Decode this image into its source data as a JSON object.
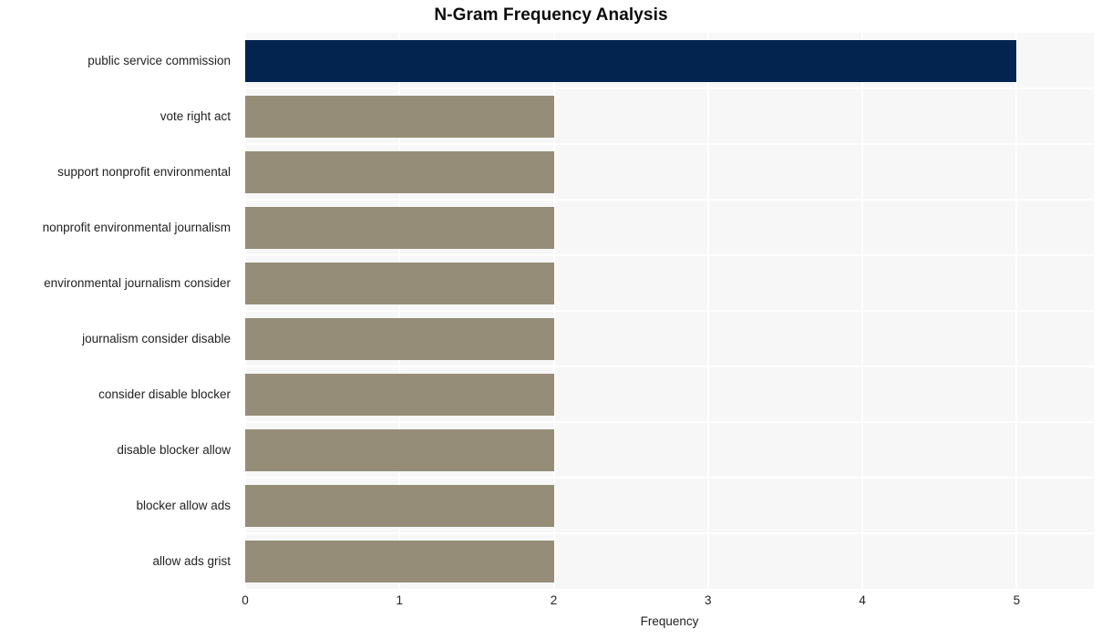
{
  "chart_data": {
    "type": "bar",
    "orientation": "horizontal",
    "title": "N-Gram Frequency Analysis",
    "xlabel": "Frequency",
    "ylabel": "",
    "xlim": [
      0,
      5.5
    ],
    "xticks": [
      "0",
      "1",
      "2",
      "3",
      "4",
      "5"
    ],
    "xtick_values": [
      0,
      1,
      2,
      3,
      4,
      5
    ],
    "grid": true,
    "grid_color": "#ffffff",
    "plot_background": "#f7f7f7",
    "page_background": "#ffffff",
    "legend": null,
    "categories": [
      "public service commission",
      "vote right act",
      "support nonprofit environmental",
      "nonprofit environmental journalism",
      "environmental journalism consider",
      "journalism consider disable",
      "consider disable blocker",
      "disable blocker allow",
      "blocker allow ads",
      "allow ads grist"
    ],
    "values": [
      5,
      2,
      2,
      2,
      2,
      2,
      2,
      2,
      2,
      2
    ],
    "bar_colors": [
      "#042450",
      "#958d78",
      "#958d78",
      "#958d78",
      "#958d78",
      "#958d78",
      "#958d78",
      "#958d78",
      "#958d78",
      "#958d78"
    ],
    "highlight_color": "#042450",
    "base_color": "#958d78"
  }
}
